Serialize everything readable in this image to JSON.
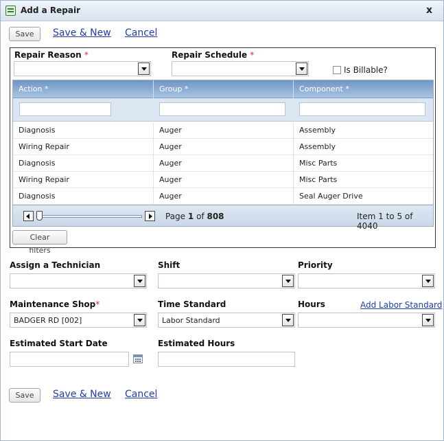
{
  "window": {
    "title": "Add a Repair",
    "close": "x"
  },
  "toolbar": {
    "save_label": "Save",
    "save_new_label": "Save & New",
    "cancel_label": "Cancel"
  },
  "repair": {
    "reason_label": "Repair Reason",
    "schedule_label": "Repair Schedule",
    "required_mark": "*",
    "billable_label": "Is Billable?",
    "reason_value": "",
    "schedule_value": ""
  },
  "grid": {
    "columns": [
      "Action *",
      "Group *",
      "Component *"
    ],
    "rows": [
      [
        "Diagnosis",
        "Auger",
        "Assembly"
      ],
      [
        "Wiring Repair",
        "Auger",
        "Assembly"
      ],
      [
        "Diagnosis",
        "Auger",
        "Misc Parts"
      ],
      [
        "Wiring Repair",
        "Auger",
        "Misc Parts"
      ],
      [
        "Diagnosis",
        "Auger",
        "Seal Auger Drive"
      ]
    ],
    "pager": {
      "page_prefix": "Page",
      "page_current": "1",
      "page_of": "of",
      "page_total": "808",
      "item_info": "Item 1 to 5 of 4040"
    },
    "clear_filters_label": "Clear filters"
  },
  "form": {
    "technician_label": "Assign a Technician",
    "shift_label": "Shift",
    "priority_label": "Priority",
    "shop_label": "Maintenance Shop",
    "shop_value": "BADGER RD [002]",
    "time_standard_label": "Time Standard",
    "time_standard_value": "Labor Standard",
    "hours_label": "Hours",
    "add_labor_label": "Add Labor Standard",
    "start_date_label": "Estimated Start Date",
    "est_hours_label": "Estimated Hours"
  }
}
